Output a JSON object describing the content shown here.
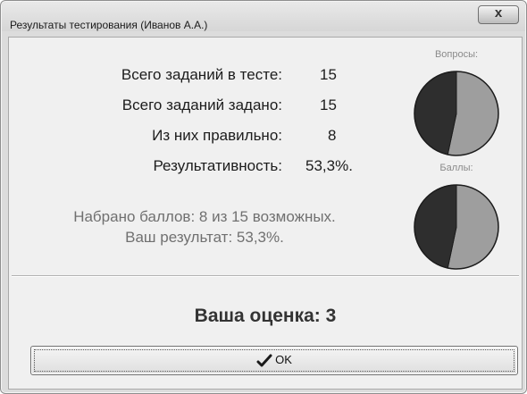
{
  "window": {
    "title": "Результаты тестирования (Иванов А.А.)",
    "close_glyph": "x"
  },
  "stats": [
    {
      "label": "Всего заданий в тесте:",
      "value": "15"
    },
    {
      "label": "Всего заданий задано:",
      "value": "15"
    },
    {
      "label": "Из них правильно:",
      "value": "8"
    },
    {
      "label": "Результативность:",
      "value": "53,3%."
    }
  ],
  "summary": {
    "line1": "Набрано баллов: 8 из 15 возможных.",
    "line2": "Ваш результат: 53,3%."
  },
  "charts": {
    "questions_caption": "Вопросы:",
    "points_caption": "Баллы:"
  },
  "grade": "Ваша оценка: 3",
  "ok_button": {
    "label": "OK",
    "icon": "checkmark-icon"
  },
  "chart_data": [
    {
      "type": "pie",
      "title": "Вопросы:",
      "values": [
        8,
        7
      ],
      "colors": [
        "#9e9e9e",
        "#2e2e2e"
      ]
    },
    {
      "type": "pie",
      "title": "Баллы:",
      "values": [
        8,
        7
      ],
      "colors": [
        "#9e9e9e",
        "#2e2e2e"
      ]
    }
  ]
}
